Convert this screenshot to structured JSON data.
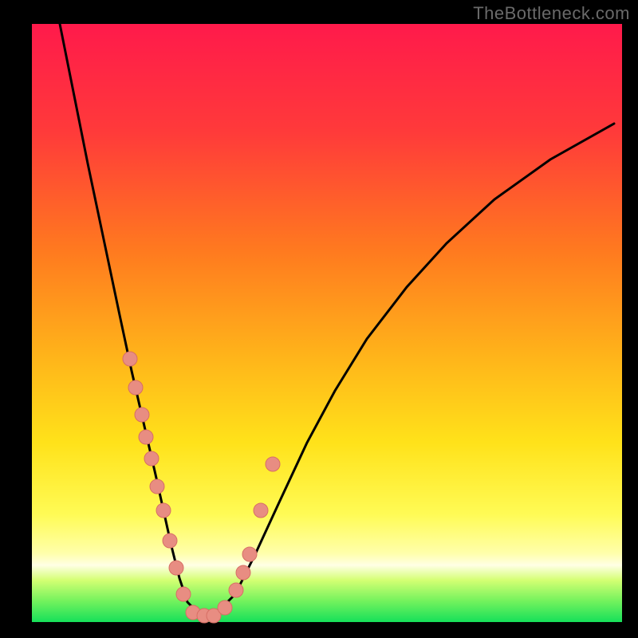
{
  "watermark": "TheBottleneck.com",
  "colors": {
    "frame": "#000000",
    "curve": "#000000",
    "dot_fill": "#e88d82",
    "dot_stroke": "#d76f65",
    "gradient_stops": [
      {
        "offset": 0.0,
        "color": "#ff1a4b"
      },
      {
        "offset": 0.18,
        "color": "#ff3a3a"
      },
      {
        "offset": 0.38,
        "color": "#ff7a1f"
      },
      {
        "offset": 0.55,
        "color": "#ffb21a"
      },
      {
        "offset": 0.7,
        "color": "#ffe21a"
      },
      {
        "offset": 0.82,
        "color": "#fffb55"
      },
      {
        "offset": 0.885,
        "color": "#ffffaa"
      },
      {
        "offset": 0.905,
        "color": "#ffffe5"
      },
      {
        "offset": 0.93,
        "color": "#d4ff73"
      },
      {
        "offset": 0.965,
        "color": "#73f25d"
      },
      {
        "offset": 1.0,
        "color": "#16e05a"
      }
    ]
  },
  "chart_data": {
    "type": "line",
    "title": "",
    "xlabel": "",
    "ylabel": "",
    "xlim": [
      40,
      780
    ],
    "ylim": [
      30,
      780
    ],
    "note": "x/y values are pixel coordinates within the 800x800 plot area; no numeric axes are visible in the image.",
    "series": [
      {
        "name": "bottleneck-curve",
        "x": [
          75,
          90,
          110,
          130,
          150,
          165,
          180,
          195,
          205,
          215,
          225,
          235,
          250,
          270,
          295,
          320,
          350,
          385,
          420,
          460,
          510,
          560,
          620,
          690,
          770
        ],
        "y": [
          30,
          105,
          205,
          300,
          395,
          465,
          530,
          595,
          640,
          685,
          725,
          755,
          770,
          770,
          745,
          695,
          630,
          555,
          490,
          425,
          360,
          305,
          250,
          200,
          155
        ]
      }
    ],
    "highlight_points": {
      "name": "marked-dots",
      "x": [
        163,
        170,
        178,
        183,
        190,
        197,
        205,
        213,
        221,
        230,
        242,
        256,
        268,
        282,
        296,
        305,
        313,
        327,
        342
      ],
      "y": [
        450,
        486,
        520,
        548,
        575,
        610,
        640,
        678,
        712,
        745,
        768,
        772,
        772,
        762,
        740,
        718,
        695,
        640,
        582
      ]
    }
  }
}
